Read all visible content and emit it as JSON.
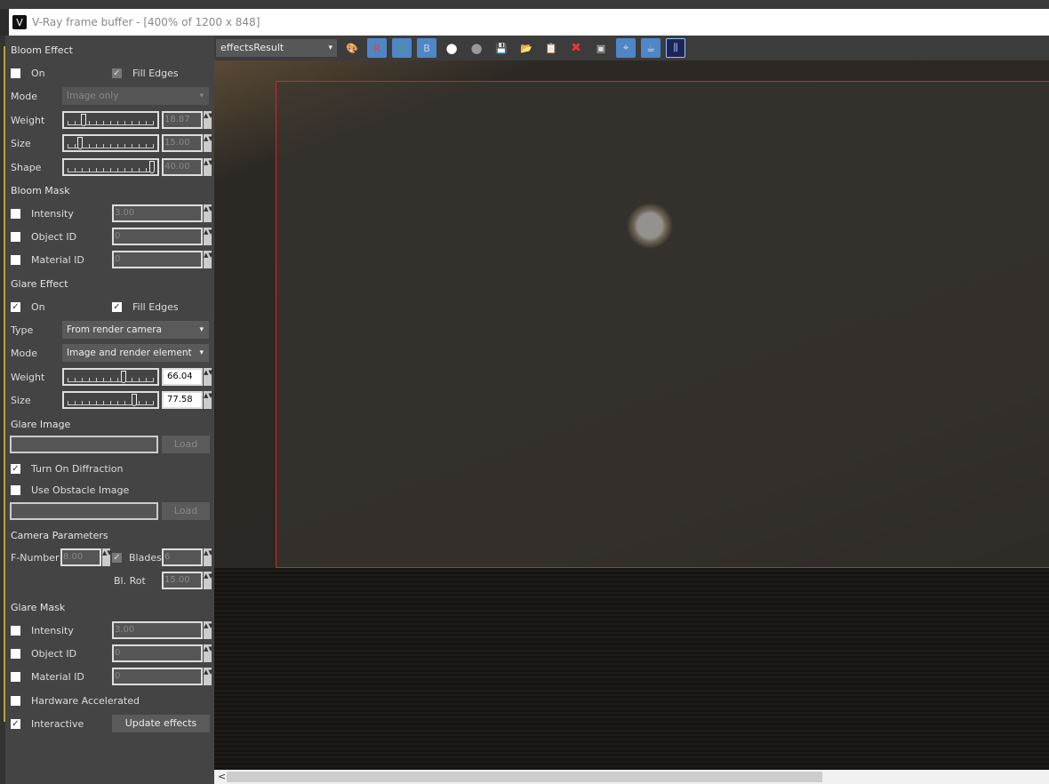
{
  "window": {
    "title": "V-Ray frame buffer - [400% of 1200 x 848]"
  },
  "bloom": {
    "title": "Bloom Effect",
    "on": "On",
    "fill_edges": "Fill Edges",
    "mode_label": "Mode",
    "mode_value": "Image only",
    "weight_label": "Weight",
    "weight": "18.87",
    "weight_frac": 0.17,
    "size_label": "Size",
    "size": "15.00",
    "size_frac": 0.13,
    "shape_label": "Shape",
    "shape": "40.00",
    "shape_frac": 1.0
  },
  "bloom_mask": {
    "title": "Bloom Mask",
    "intensity_label": "Intensity",
    "intensity": "3.00",
    "object_id_label": "Object ID",
    "object_id": "0",
    "material_id_label": "Material ID",
    "material_id": "0"
  },
  "glare": {
    "title": "Glare Effect",
    "on": "On",
    "fill_edges": "Fill Edges",
    "type_label": "Type",
    "type_value": "From render camera",
    "mode_label": "Mode",
    "mode_value": "Image and render element",
    "weight_label": "Weight",
    "weight": "66.04",
    "weight_frac": 0.66,
    "size_label": "Size",
    "size": "77.58",
    "size_frac": 0.78
  },
  "glare_image": {
    "title": "Glare Image",
    "load": "Load",
    "diffraction": "Turn On Diffraction",
    "obstacle": "Use Obstacle Image",
    "load2": "Load"
  },
  "camera": {
    "title": "Camera Parameters",
    "fnumber_label": "F-Number",
    "fnumber": "8.00",
    "blades_label": "Blades",
    "blades": "6",
    "blrot_label": "Bl. Rot",
    "blrot": "15.00"
  },
  "glare_mask": {
    "title": "Glare Mask",
    "intensity_label": "Intensity",
    "intensity": "3.00",
    "object_id_label": "Object ID",
    "object_id": "0",
    "material_id_label": "Material ID",
    "material_id": "0"
  },
  "hardware": "Hardware Accelerated",
  "interactive": "Interactive",
  "update": "Update effects",
  "toolbar": {
    "channel": "effectsResult",
    "r": "R",
    "g": "G",
    "b": "B"
  },
  "scroll": {
    "left_arrow": "<"
  }
}
